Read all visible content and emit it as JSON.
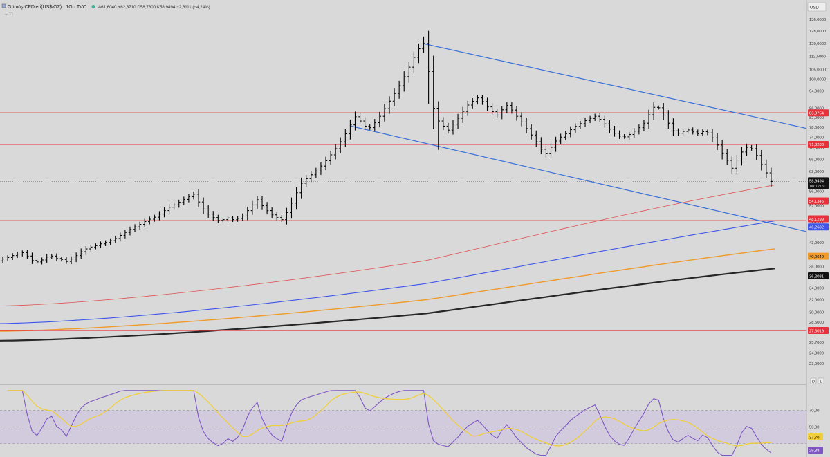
{
  "header": {
    "title": "Gümüş CFDleri(US$/OZ) · 1G · TVC",
    "ohlc": "A61,6040  Y62,3710  D58,7300  K58,9494  −2,6111 (−4,24%)",
    "sub": "11",
    "currency": "USD"
  },
  "colors": {
    "background": "#d9d9d9",
    "candle": "#000000",
    "channel": "#3a6fd8",
    "support": "#e8313b",
    "ma_thin": "#e05252",
    "ma_blue": "#3d55e8",
    "ma_orange": "#f09a2a",
    "ma_black": "#262626",
    "rsi_line": "#7e57c2",
    "rsi_ma": "#f0cf3c",
    "rsi_band": "#cfc9dd"
  },
  "chart_data": [
    {
      "type": "candlestick",
      "scale": "log",
      "ylim": [
        21.5,
        142
      ],
      "y_ticks": [
        23.0,
        24.3,
        25.7,
        27.1,
        28.5,
        30.0,
        32.0,
        34.0,
        36.0,
        38.0,
        43.0,
        48.0,
        52.0,
        56.0,
        62.0,
        66.0,
        70.0,
        74.0,
        78.0,
        82.0,
        86.0,
        94.0,
        100.0,
        105.0,
        112.5,
        120.0,
        128.0,
        136.0
      ],
      "y_tick_labels": [
        "23,0000",
        "24,3000",
        "25,7000",
        "27,1000",
        "28,5000",
        "30,0000",
        "32,0000",
        "34,0000",
        "36,0000",
        "38,0000",
        "43,0000",
        "48,0000",
        "52,0000",
        "56,0000",
        "62,0000",
        "66,0000",
        "70,0000",
        "74,0000",
        "78,0000",
        "82,0000",
        "86,0000",
        "94,0000",
        "100,0000",
        "105,0000",
        "112,5000",
        "120,0000",
        "128,0000",
        "136,0000"
      ],
      "close": [
        39.5,
        39.8,
        40.2,
        40.5,
        40.8,
        40.1,
        39.2,
        38.9,
        39.3,
        39.9,
        40.1,
        39.6,
        39.4,
        39.0,
        39.5,
        40.2,
        41.0,
        41.6,
        42.0,
        42.3,
        42.7,
        43.0,
        43.4,
        43.9,
        44.6,
        45.3,
        46.0,
        46.6,
        47.2,
        47.9,
        48.5,
        49.0,
        49.8,
        50.7,
        51.6,
        52.2,
        52.9,
        53.7,
        54.5,
        55.2,
        53.0,
        51.1,
        49.8,
        48.9,
        48.2,
        48.4,
        48.8,
        48.4,
        48.7,
        49.3,
        50.7,
        52.2,
        53.6,
        52.0,
        50.7,
        49.6,
        48.9,
        48.4,
        50.2,
        52.7,
        55.6,
        58.4,
        59.8,
        61.0,
        62.2,
        63.8,
        65.6,
        67.6,
        69.8,
        72.3,
        75.4,
        78.9,
        82.3,
        80.5,
        78.4,
        77.8,
        79.8,
        82.5,
        85.8,
        89.2,
        92.8,
        96.6,
        101.2,
        106.3,
        111.8,
        116.9,
        120.1,
        104.0,
        86.0,
        80.5,
        78.4,
        76.8,
        79.2,
        81.7,
        84.6,
        87.4,
        89.1,
        90.7,
        89.0,
        86.6,
        84.5,
        83.0,
        85.3,
        87.2,
        85.2,
        82.5,
        80.1,
        77.4,
        74.9,
        72.3,
        69.6,
        68.0,
        70.3,
        72.6,
        74.1,
        75.4,
        77.0,
        78.3,
        79.4,
        80.7,
        81.6,
        82.5,
        81.2,
        79.3,
        77.2,
        75.6,
        74.5,
        74.2,
        75.1,
        76.4,
        77.8,
        79.6,
        83.1,
        86.4,
        86.2,
        83.0,
        79.6,
        76.5,
        75.6,
        76.3,
        76.9,
        76.1,
        75.4,
        76.2,
        75.7,
        73.8,
        71.1,
        68.0,
        65.7,
        63.1,
        65.8,
        68.6,
        70.3,
        69.8,
        67.4,
        64.3,
        61.6,
        58.95
      ],
      "support_levels": [
        83.9754,
        71.3283,
        48.1299,
        27.3019
      ],
      "support_labels": [
        "83,9754",
        "71,3283",
        "48,1299",
        "27,3019"
      ],
      "price_label": "58,9494",
      "countdown": "08:12:09",
      "ma_values": [
        54.1345,
        46.2682,
        40.064,
        36.2081
      ],
      "ma_labels": [
        "54,1345",
        "46,2682",
        "40,0640",
        "36,2081"
      ],
      "ma_series": [
        {
          "start": 31.0,
          "end": 54.1345
        },
        {
          "start": 28.3,
          "end": 46.2682
        },
        {
          "start": 27.2,
          "end": 40.064
        },
        {
          "start": 25.9,
          "end": 36.2081
        }
      ],
      "channel_lines": [
        {
          "from": [
            86,
            120.0
          ],
          "to": [
            177,
            77.5
          ]
        },
        {
          "from": [
            71,
            78.5
          ],
          "to": [
            177,
            45.5
          ]
        }
      ]
    },
    {
      "type": "line",
      "name": "RSI",
      "ylim": [
        14,
        98
      ],
      "y_ticks": [
        70,
        50
      ],
      "y_tick_labels": [
        "70,00",
        "50,00"
      ],
      "band": [
        30,
        70
      ],
      "current_labels": [
        "37,70",
        "29,38"
      ]
    }
  ]
}
